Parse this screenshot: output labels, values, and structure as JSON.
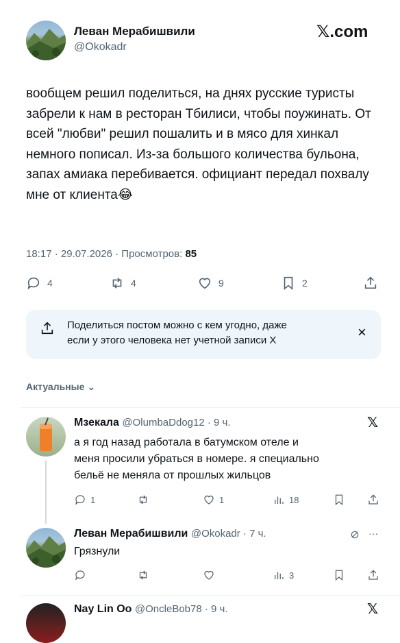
{
  "post": {
    "author_name": "Леван Мерабишвили",
    "author_handle": "@Okokadr",
    "source": "𝕏.com",
    "text": "вообщем решил поделиться, на днях русские туристы забрели к нам в ресторан Тбилиси, чтобы поужинать. От всей \"любви\" решил пошалить и в мясо для хинкал немного пописал. Из-за большого количества бульона, запах амиака перебивается. официант передал похвалу мне от клиента😂",
    "time": "18:17 · 29.07.2026 · ",
    "views_label": "Просмотров:",
    "views": "85",
    "actions": {
      "replies": "4",
      "reposts": "4",
      "likes": "9",
      "bookmarks": "2"
    }
  },
  "share_banner": {
    "text_line1": "Поделиться постом можно с кем угодно, даже",
    "text_line2": "если у этого человека нет учетной записи X",
    "close": "×"
  },
  "sort": {
    "label": "Актуальные",
    "chevron": "⌄"
  },
  "replies": [
    {
      "name": "Мзекала",
      "handle": "@OlumbaDdog12",
      "time": " · 9 ч.",
      "text_lines": [
        "а я год назад работала в батумском отеле и",
        "меня просили убраться в номере. я специально",
        "бельё не меняла от прошлых жильцов"
      ],
      "replies": "1",
      "reposts": "",
      "likes": "1",
      "views": "18",
      "badge": "𝕏"
    },
    {
      "name": "Леван Мерабишвили",
      "handle": "@Okokadr",
      "time": " · 7 ч.",
      "text_lines": [
        "Грязнули"
      ],
      "replies": "",
      "reposts": "",
      "likes": "",
      "views": "3",
      "badge": "···"
    },
    {
      "name": "Nay Lin Oo",
      "handle": "@OncleBob78",
      "time": " · 9 ч.",
      "badge": "𝕏"
    }
  ]
}
